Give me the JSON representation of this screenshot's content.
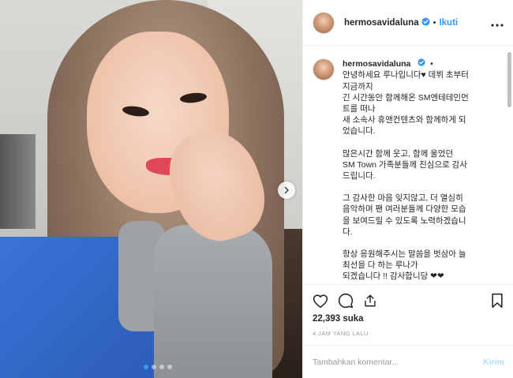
{
  "post": {
    "username": "hermosavidaluna",
    "verified": true,
    "follow_label": "Ikuti",
    "more_icon": "more-icon",
    "carousel": {
      "slides": 4,
      "active_slide": 1
    }
  },
  "caption": {
    "username": "hermosavidaluna",
    "lines": [
      "안녕하세요 루나입니다♥ 데뷔 초부터",
      "지금까지",
      "긴 시간동안 함께해온 SM엔테테인먼",
      "트를 떠나",
      "새 소속사 휴앤컨텐츠와 함께하게 되",
      "었습니다.",
      "",
      "많은시간 함께 웃고, 함께 울었던",
      "SM Town 가족분들께 진심으로 감사",
      "드립니다.",
      "",
      "그 감사한 마음 잊지않고, 더 열심히",
      "음악하며 팬 여러분들께 다양한 모습",
      "을 보여드릴 수 있도록 노력하겠습니",
      "다.",
      "",
      "항상 응원해주시는 말씀을 벗삼아 늘",
      "최선을 다 하는 루나가",
      "되겠습니다 !! 감사합니당 ❤❤"
    ]
  },
  "actions": {
    "likes": "22,393 suka",
    "timestamp": "4 JAM YANG LALU"
  },
  "comment": {
    "placeholder": "Tambahkan komentar...",
    "post_label": "Kirim"
  },
  "colors": {
    "accent": "#3897f0",
    "text": "#262626",
    "muted": "#999999",
    "post_disabled": "#b2dffc"
  }
}
